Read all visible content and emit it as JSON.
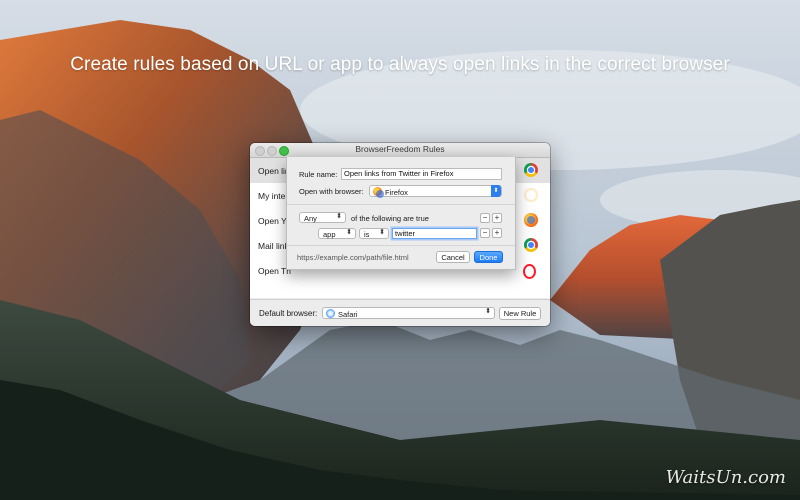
{
  "headline": "Create rules based on URL or app to always open links in the correct browser",
  "watermark": "WaitsUn.com",
  "window": {
    "title": "BrowserFreedom Rules",
    "rules": [
      {
        "label": "Open lin",
        "icon": "chrome-icon",
        "selected": true
      },
      {
        "label": "My inter",
        "icon": "safari-icon"
      },
      {
        "label": "Open Yo",
        "icon": "firefox-icon"
      },
      {
        "label": "Mail link",
        "icon": "chrome-icon"
      },
      {
        "label": "Open Th",
        "icon": "opera-icon"
      }
    ],
    "default_browser_label": "Default browser:",
    "default_browser_value": "Safari",
    "new_rule_label": "New Rule"
  },
  "sheet": {
    "rule_name_label": "Rule name:",
    "rule_name_value": "Open links from Twitter in Firefox",
    "open_with_label": "Open with browser:",
    "open_with_value": "Firefox",
    "match_mode": "Any",
    "match_suffix": "of the following are true",
    "condition": {
      "field": "app",
      "operator": "is",
      "value": "twitter"
    },
    "url_hint": "https://example.com/path/file.html",
    "cancel_label": "Cancel",
    "done_label": "Done"
  },
  "colors": {
    "accent": "#2d7ff0",
    "zoom_light": "#3fc14a"
  }
}
